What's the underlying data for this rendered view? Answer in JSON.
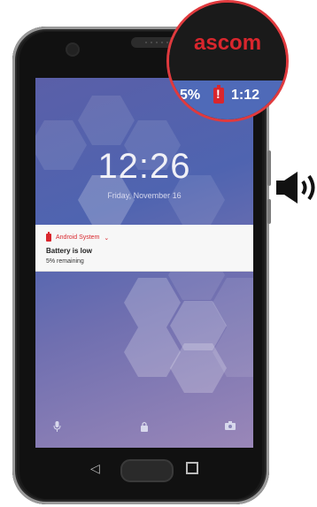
{
  "zoom": {
    "brand": "ascom",
    "battery_percent": "5%",
    "time": "1:12"
  },
  "lockscreen": {
    "clock": "12:26",
    "date": "Friday, November 16"
  },
  "notification": {
    "app_name": "Android System",
    "title": "Battery is low",
    "body": "5% remaining"
  },
  "icons": {
    "voice": "mic-icon",
    "lock": "lock-icon",
    "camera": "camera-icon",
    "back": "back-icon",
    "home": "home-button",
    "recents": "recents-icon",
    "sound": "speaker-sound-icon"
  },
  "colors": {
    "brand_red": "#d9262d",
    "callout_ring": "#e03a3e",
    "status_bar": "#4f6ab8"
  }
}
